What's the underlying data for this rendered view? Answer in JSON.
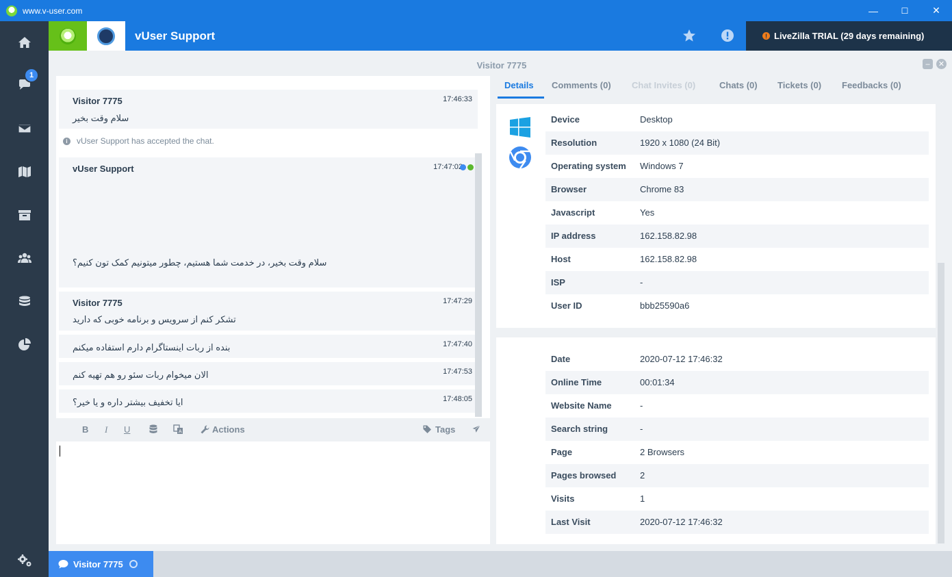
{
  "window": {
    "title": "www.v-user.com",
    "controls": [
      "—",
      "☐",
      "✕"
    ]
  },
  "sidebar": {
    "items": [
      {
        "icon": "home-icon"
      },
      {
        "icon": "chat-icon",
        "badge": "1"
      },
      {
        "icon": "mail-icon"
      },
      {
        "icon": "map-icon"
      },
      {
        "icon": "archive-icon"
      },
      {
        "icon": "users-icon"
      },
      {
        "icon": "database-icon"
      },
      {
        "icon": "pie-chart-icon"
      }
    ],
    "settings_icon": "gears-icon"
  },
  "header": {
    "brand": "vUser Support",
    "trial": "LiveZilla TRIAL (29 days remaining)",
    "trial_icon": "!",
    "accent": "#1a7ae0"
  },
  "panel": {
    "title": "Visitor 7775"
  },
  "chat": {
    "messages": [
      {
        "name": "Visitor 7775",
        "time": "17:46:33",
        "text": "سلام وقت بخیر"
      },
      {
        "system": "vUser Support has accepted the chat."
      },
      {
        "name": "vUser Support",
        "time": "17:47:02",
        "text": "سلام وقت بخیر، در خدمت شما هستیم، چطور میتونیم کمک تون کنیم؟"
      },
      {
        "name": "Visitor 7775",
        "time": "17:47:29",
        "text": "تشکر کنم از سرویس و برنامه خوبی که دارید"
      },
      {
        "name": "",
        "time": "17:47:40",
        "text": "بنده از ربات اینستاگرام دارم استفاده میکنم"
      },
      {
        "name": "",
        "time": "17:47:53",
        "text": "الان میخوام ربات سئو رو هم تهیه کنم"
      },
      {
        "name": "",
        "time": "17:48:05",
        "text": "ایا تخفیف بیشتر داره و یا خیر؟"
      }
    ]
  },
  "toolbar": {
    "bold": "B",
    "italic": "I",
    "underline": "U",
    "actions": "Actions",
    "tags": "Tags"
  },
  "composer": {
    "value": ""
  },
  "tabs": [
    {
      "label": "Details",
      "active": true
    },
    {
      "label": "Comments (0)"
    },
    {
      "label": "Chat Invites (0)",
      "disabled": true
    },
    {
      "label": "Chats (0)"
    },
    {
      "label": "Tickets (0)"
    },
    {
      "label": "Feedbacks (0)"
    }
  ],
  "details": {
    "system": [
      {
        "k": "Device",
        "v": "Desktop"
      },
      {
        "k": "Resolution",
        "v": "1920 x 1080 (24 Bit)"
      },
      {
        "k": "Operating system",
        "v": "Windows 7"
      },
      {
        "k": "Browser",
        "v": "Chrome 83"
      },
      {
        "k": "Javascript",
        "v": "Yes"
      },
      {
        "k": "IP address",
        "v": "162.158.82.98"
      },
      {
        "k": "Host",
        "v": "162.158.82.98"
      },
      {
        "k": "ISP",
        "v": "-"
      },
      {
        "k": "User ID",
        "v": "bbb25590a6"
      }
    ],
    "visit": [
      {
        "k": "Date",
        "v": "2020-07-12 17:46:32"
      },
      {
        "k": "Online Time",
        "v": "00:01:34"
      },
      {
        "k": "Website Name",
        "v": "-"
      },
      {
        "k": "Search string",
        "v": "-"
      },
      {
        "k": "Page",
        "v": "2 Browsers"
      },
      {
        "k": "Pages browsed",
        "v": "2"
      },
      {
        "k": "Visits",
        "v": "1"
      },
      {
        "k": "Last Visit",
        "v": "2020-07-12 17:46:32"
      }
    ]
  },
  "bottom": {
    "tab_label": "Visitor 7775"
  }
}
